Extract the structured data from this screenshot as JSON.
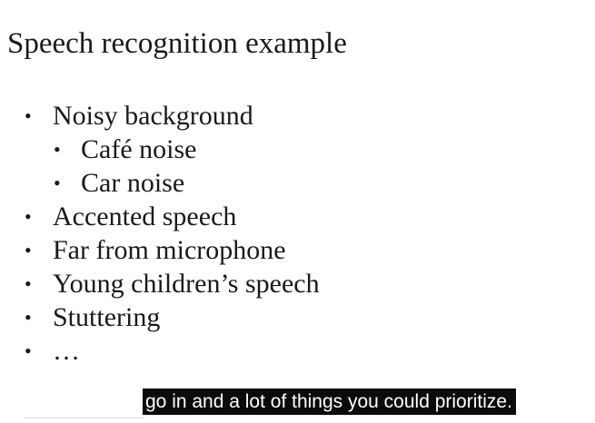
{
  "slide": {
    "title": "Speech recognition example",
    "bullets": [
      {
        "text": "Noisy background",
        "level": 1
      },
      {
        "text": "Café noise",
        "level": 2
      },
      {
        "text": "Car noise",
        "level": 2
      },
      {
        "text": "Accented speech",
        "level": 1
      },
      {
        "text": "Far from microphone",
        "level": 1
      },
      {
        "text": "Young children’s speech",
        "level": 1
      },
      {
        "text": "Stuttering",
        "level": 1
      },
      {
        "text": "…",
        "level": 1
      }
    ],
    "bullet_symbol": "•"
  },
  "caption": {
    "text": "go in and a lot of things you could prioritize."
  },
  "colors": {
    "background": "#ffffff",
    "text": "#1a1a1a",
    "caption_background": "#0b0b0b",
    "caption_text": "#ffffff"
  }
}
